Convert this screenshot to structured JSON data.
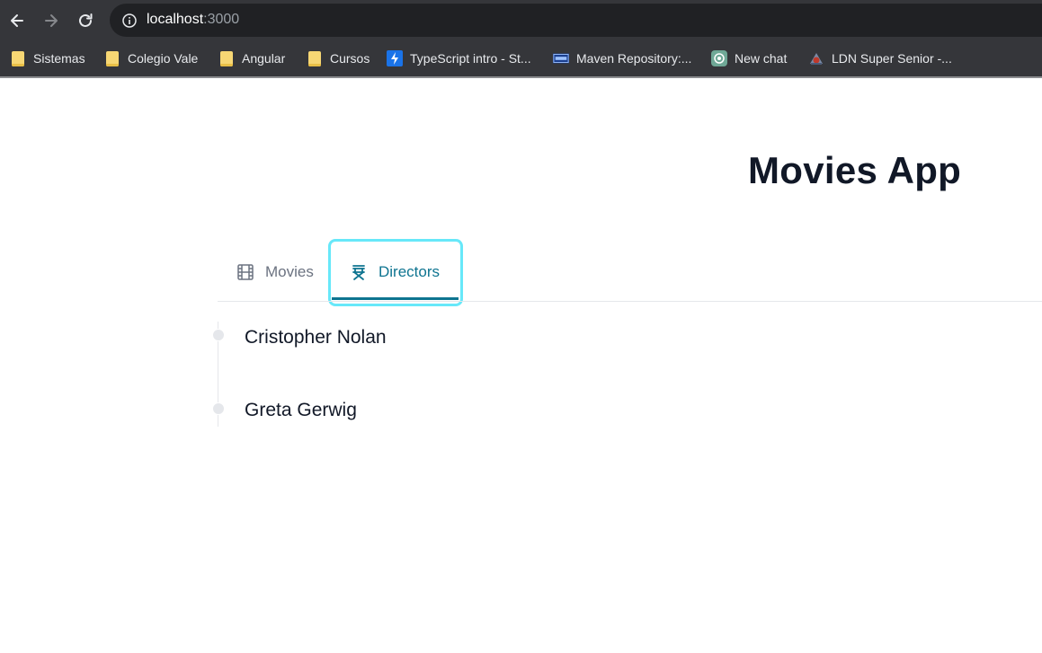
{
  "browser": {
    "url_host": "localhost",
    "url_port": ":3000",
    "bookmarks": [
      {
        "label": "Sistemas",
        "icon": "folder-icon"
      },
      {
        "label": "Colegio Vale",
        "icon": "folder-icon"
      },
      {
        "label": "Angular",
        "icon": "folder-icon"
      },
      {
        "label": "Cursos",
        "icon": "folder-icon"
      },
      {
        "label": "TypeScript intro - St...",
        "icon": "lightning-icon"
      },
      {
        "label": "Maven Repository:...",
        "icon": "maven-icon"
      },
      {
        "label": "New chat",
        "icon": "chatgpt-icon"
      },
      {
        "label": "LDN Super Senior -...",
        "icon": "ldn-icon"
      }
    ]
  },
  "app": {
    "title": "Movies App",
    "tabs": [
      {
        "label": "Movies",
        "icon": "film-icon",
        "active": false
      },
      {
        "label": "Directors",
        "icon": "director-chair-icon",
        "active": true
      }
    ],
    "directors": [
      {
        "name": "Cristopher Nolan"
      },
      {
        "name": "Greta Gerwig"
      }
    ]
  },
  "colors": {
    "active_tab": "#0e7490",
    "focus_ring": "#67e8f9",
    "inactive_tab": "#6b7280",
    "text": "#111827"
  }
}
